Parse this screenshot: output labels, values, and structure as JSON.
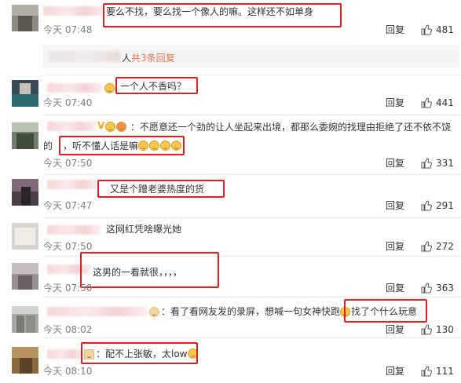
{
  "comments": [
    {
      "text": "要么不找，要么找一个像人的嘛。这样还不如单身",
      "time": "今天 07:48",
      "reply": "回复",
      "likes": "481"
    },
    {
      "text": "一个人不香吗？",
      "time": "今天 07:40",
      "reply": "回复",
      "likes": "441"
    },
    {
      "text_line1": "：不愿意还一个劲的让人坐起来出境，都那么委婉的找理由拒绝了还不依不饶",
      "text_line2_prefix": "的",
      "text_line2": "，听不懂人话是嘛",
      "time": "今天 07:50",
      "reply": "回复",
      "likes": "331"
    },
    {
      "text": "又是个蹭老婆热度的货",
      "time": "今天 07:47",
      "reply": "回复",
      "likes": "291"
    },
    {
      "text": "这网红凭啥曝光她",
      "time": "今天 07:50",
      "reply": "回复",
      "likes": "272"
    },
    {
      "text": "这男的一看就很，，，，",
      "time": "今天 07:50",
      "reply": "回复",
      "likes": "363"
    },
    {
      "text": "：看了看网友发的录屏，想喊一句女神快跑",
      "text_boxed": "找了个什么玩意",
      "time": "今天 08:02",
      "reply": "回复",
      "likes": "130"
    },
    {
      "text": "：配不上张敏，太low",
      "time": "今天 08:10",
      "reply": "回复",
      "likes": "111"
    }
  ],
  "subreplies": {
    "name_suffix": "人",
    "link": "共3条回复"
  },
  "colors": {
    "highlight_box": "#e02020",
    "link": "#eb7350",
    "time": "#808080"
  }
}
